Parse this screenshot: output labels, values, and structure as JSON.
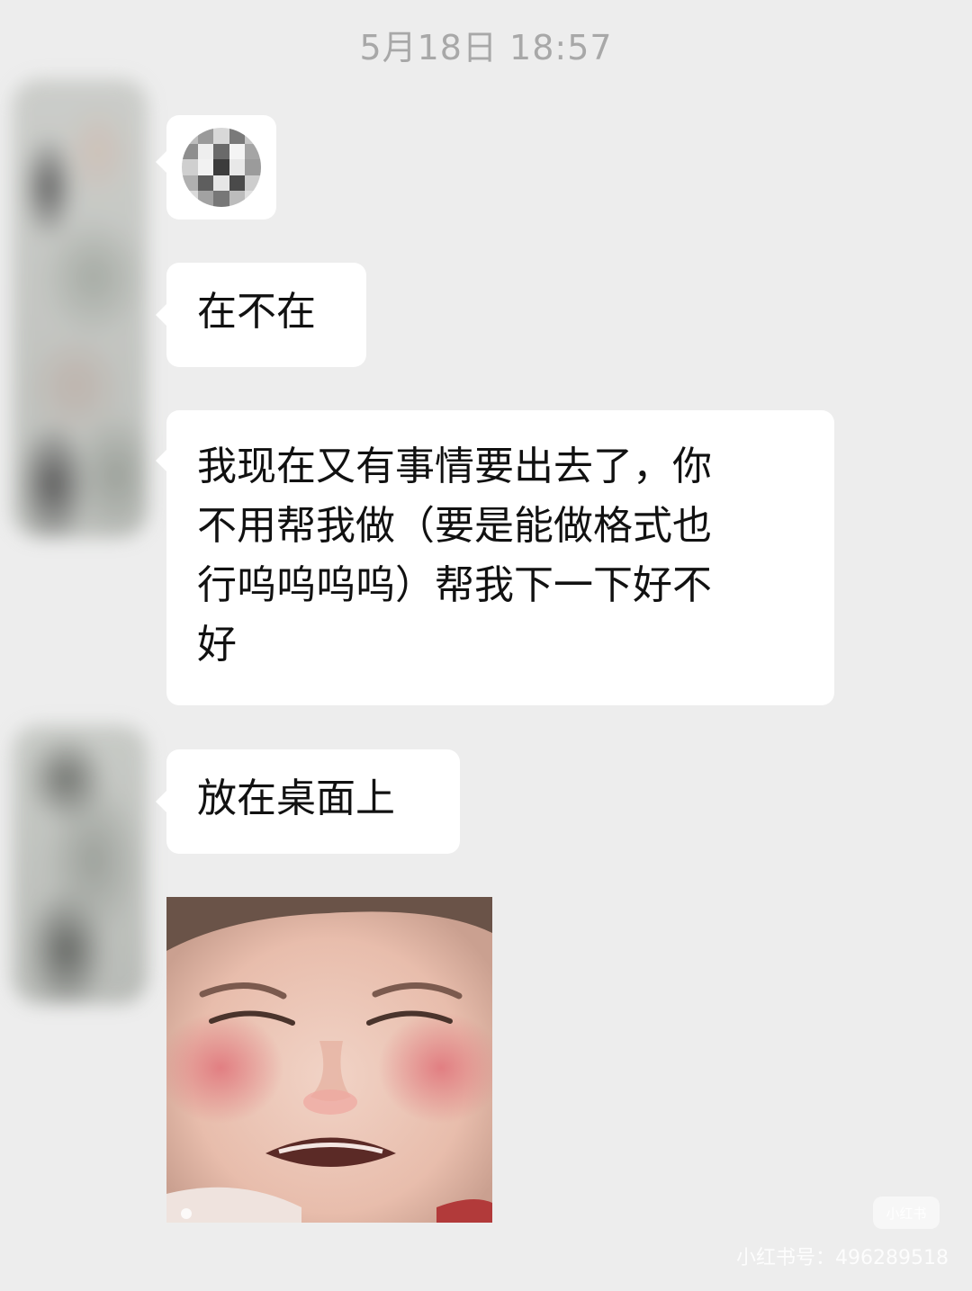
{
  "chat": {
    "timestamp": "5月18日 18:57",
    "messages": [
      {
        "type": "emoji",
        "description": "pixelated-emoji-sticker"
      },
      {
        "type": "text",
        "text": "在不在"
      },
      {
        "type": "text",
        "lines": [
          "我现在又有事情要出去了，你",
          "不用帮我做（要是能做格式也",
          "行呜呜呜呜）帮我下一下好不",
          "好"
        ]
      },
      {
        "type": "text",
        "text": "放在桌面上"
      },
      {
        "type": "image",
        "description": "crying-child-sticker"
      }
    ]
  },
  "watermark": {
    "badge": "小红书",
    "text": "小红书号：496289518"
  },
  "colors": {
    "background": "#ededed",
    "bubble": "#ffffff",
    "timestamp": "#a8a8a8"
  }
}
